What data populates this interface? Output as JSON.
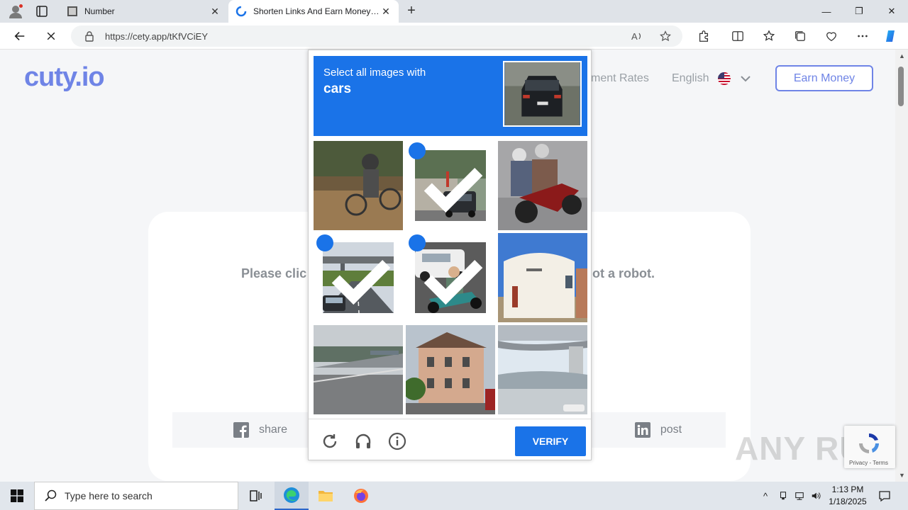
{
  "browser": {
    "tabs": [
      {
        "title": "Number",
        "favicon": "document-favicon"
      },
      {
        "title": "Shorten Links And Earn Money | cety",
        "favicon": "cety-favicon"
      }
    ],
    "url": "https://cety.app/tKfVCiEY"
  },
  "site": {
    "logo": "cuty.io",
    "nav_rates": "ment Rates",
    "language": "English",
    "earn_button": "Earn Money",
    "notice_left": "Please clic",
    "notice_right": "ot a robot.",
    "share_facebook": "share",
    "share_linkedin": "post"
  },
  "captcha": {
    "instruction": "Select all images with",
    "target": "cars",
    "tiles": [
      {
        "content": "bicycle on dirt road",
        "selected": false
      },
      {
        "content": "car on street",
        "selected": true
      },
      {
        "content": "motorcycle riders",
        "selected": false
      },
      {
        "content": "highway with car",
        "selected": true
      },
      {
        "content": "scooter and car",
        "selected": true
      },
      {
        "content": "white building",
        "selected": false
      },
      {
        "content": "empty highway",
        "selected": false
      },
      {
        "content": "apartment building",
        "selected": false
      },
      {
        "content": "overpass bridge",
        "selected": false
      }
    ],
    "verify_label": "VERIFY",
    "accent": "#1a73e8"
  },
  "recaptcha_badge": {
    "terms": "Privacy - Terms"
  },
  "watermark": "ANY RUN",
  "taskbar": {
    "search_placeholder": "Type here to search",
    "time": "1:13 PM",
    "date": "1/18/2025"
  }
}
